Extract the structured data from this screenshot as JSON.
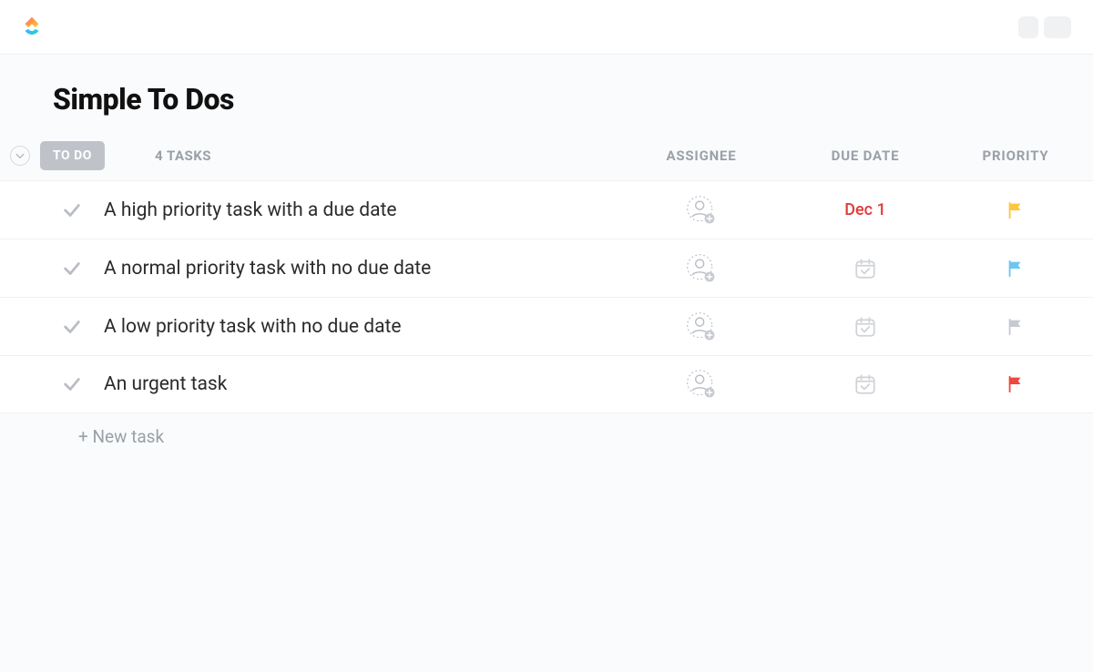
{
  "page_title": "Simple To Dos",
  "status": {
    "label": "TO DO",
    "count_label": "4 TASKS"
  },
  "columns": {
    "assignee": "ASSIGNEE",
    "due_date": "DUE DATE",
    "priority": "PRIORITY"
  },
  "tasks": [
    {
      "title": "A high priority task with a due date",
      "due_date": "Dec 1",
      "due_state": "overdue",
      "priority_color": "#ffc53d"
    },
    {
      "title": "A normal priority task with no due date",
      "due_date": "",
      "due_state": "none",
      "priority_color": "#6ec6f0"
    },
    {
      "title": "A low priority task with no due date",
      "due_date": "",
      "due_state": "none",
      "priority_color": "#c7cbd1"
    },
    {
      "title": "An urgent task",
      "due_date": "",
      "due_state": "none",
      "priority_color": "#f0473e"
    }
  ],
  "new_task_label": "+ New task"
}
